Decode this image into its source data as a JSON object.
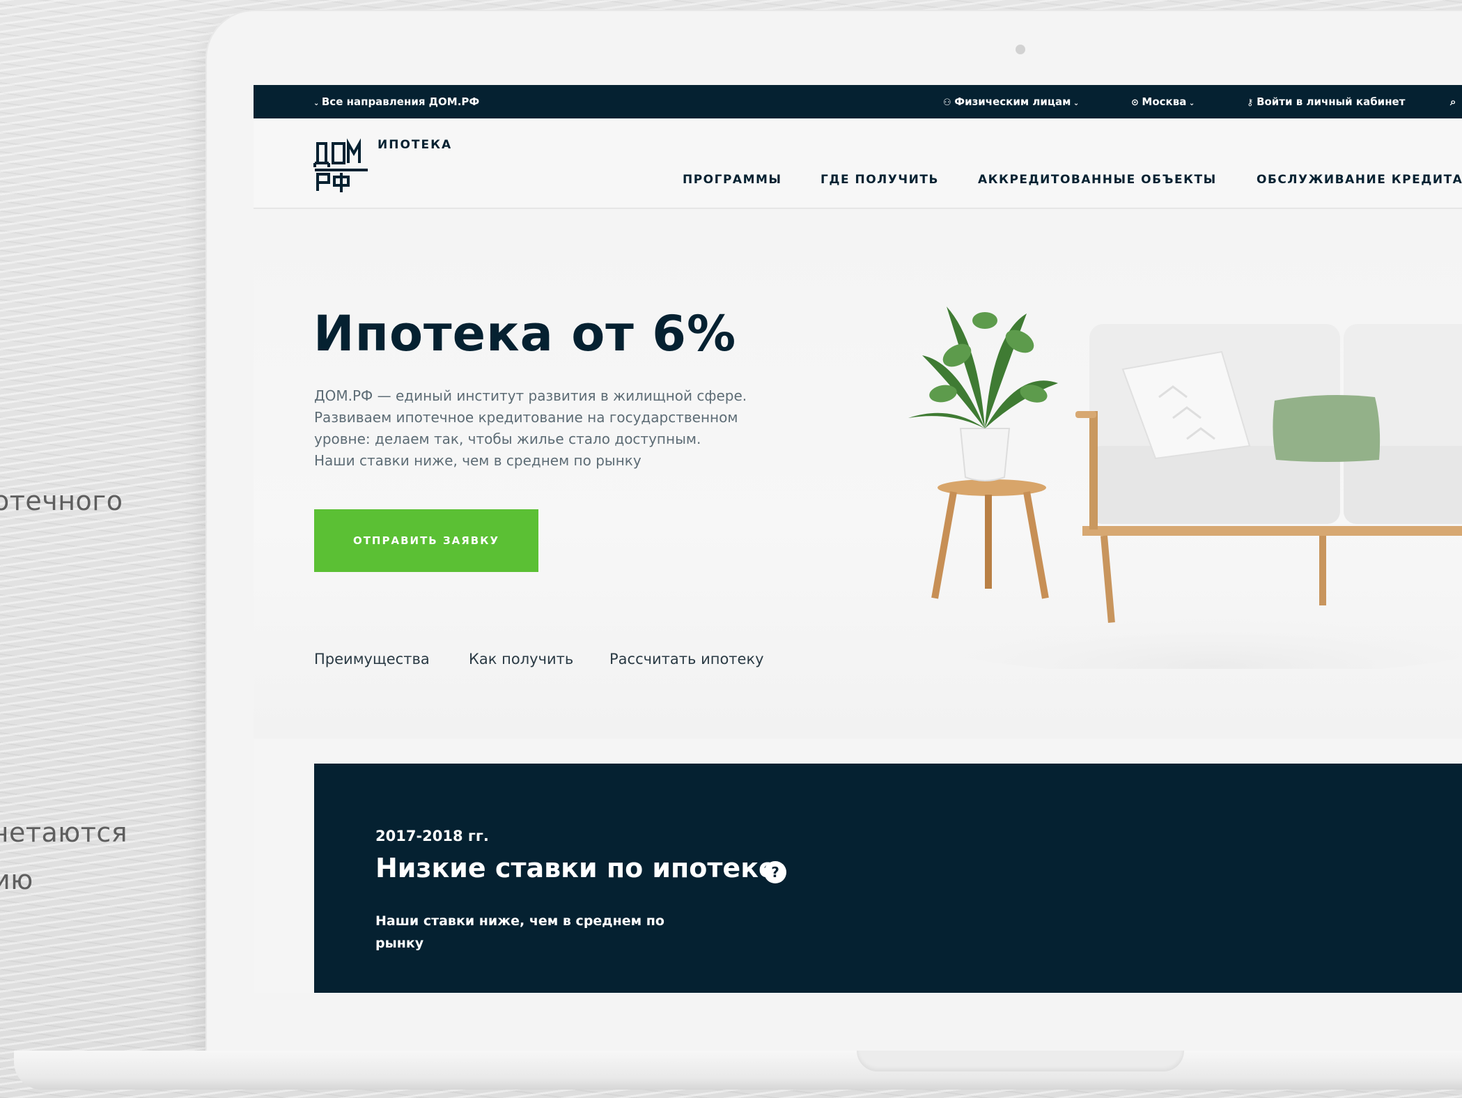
{
  "side_text": [
    "отечного",
    ",",
    "четаются",
    "ию"
  ],
  "topbar": {
    "directions": "Все направления ДОМ.РФ",
    "audience": "Физическим лицам",
    "city": "Москва",
    "login": "Войти в личный кабинет"
  },
  "header": {
    "logo_sub": "ИПОТЕКА",
    "nav": [
      "ПРОГРАММЫ",
      "ГДЕ ПОЛУЧИТЬ",
      "АККРЕДИТОВАННЫЕ ОБЪЕКТЫ",
      "ОБСЛУЖИВАНИЕ КРЕДИТА"
    ]
  },
  "hero": {
    "title": "Ипотека от 6%",
    "text": [
      "ДОМ.РФ — единый институт развития в жилищной сфере.",
      "Развиваем ипотечное кредитование на государственном",
      "уровне: делаем так, чтобы жилье стало доступным.",
      "Наши ставки ниже, чем в среднем по рынку"
    ],
    "cta": "ОТПРАВИТЬ ЗАЯВКУ"
  },
  "anchors": [
    "Преимущества",
    "Как получить",
    "Рассчитать ипотеку"
  ],
  "rates": {
    "year": "2017-2018 гг.",
    "title": "Низкие ставки по ипотеке",
    "help_icon": "?",
    "text": [
      "Наши ставки ниже, чем в среднем по",
      "рынку"
    ]
  },
  "colors": {
    "dark": "#052131",
    "accent_green": "#5bc034"
  }
}
